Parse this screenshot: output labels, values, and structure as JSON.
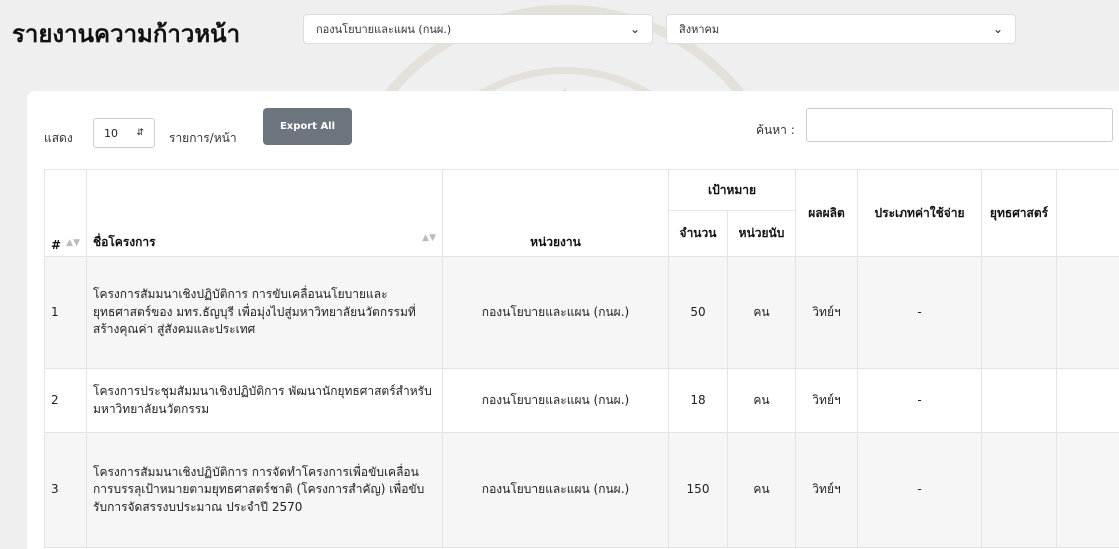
{
  "header": {
    "title": "รายงานความก้าวหน้า",
    "department_select": "กองนโยบายและแผน (กนผ.)",
    "month_select": "สิงหาคม"
  },
  "controls": {
    "show_label": "แสดง",
    "page_length": "10",
    "per_page_label": "รายการ/หน้า",
    "export_label": "Export All",
    "search_label": "ค้นหา :",
    "search_value": ""
  },
  "table": {
    "headers": {
      "index": "#",
      "project": "ชื่อโครงการ",
      "unit": "หน่วยงาน",
      "target": "เป้าหมาย",
      "amount": "จำนวน",
      "count_unit": "หน่วยนับ",
      "output": "ผลผลิต",
      "expense_type": "ประเภทค่าใช้จ่าย",
      "strategy": "ยุทธศาสตร์"
    },
    "rows": [
      {
        "index": "1",
        "project": "โครงการสัมมนาเชิงปฏิบัติการ การขับเคลื่อนนโยบายและยุทธศาสตร์ของ มทร.ธัญบุรี เพื่อมุ่งไปสู่มหาวิทยาลัยนวัตกรรมที่สร้างคุณค่า สู่สังคมและประเทศ",
        "unit": "กองนโยบายและแผน (กนผ.)",
        "amount": "50",
        "count_unit": "คน",
        "output": "วิทย์ฯ",
        "expense_type": "-",
        "strategy": ""
      },
      {
        "index": "2",
        "project": "โครงการประชุมสัมมนาเชิงปฏิบัติการ พัฒนานักยุทธศาสตร์สำหรับมหาวิทยาลัยนวัตกรรม",
        "unit": "กองนโยบายและแผน (กนผ.)",
        "amount": "18",
        "count_unit": "คน",
        "output": "วิทย์ฯ",
        "expense_type": "-",
        "strategy": ""
      },
      {
        "index": "3",
        "project": "โครงการสัมมนาเชิงปฏิบัติการ การจัดทำโครงการเพื่อขับเคลื่อนการบรรลุเป้าหมายตามยุทธศาสตร์ชาติ (โครงการสำคัญ) เพื่อขับรับการจัดสรรงบประมาณ ประจำปี 2570",
        "unit": "กองนโยบายและแผน (กนผ.)",
        "amount": "150",
        "count_unit": "คน",
        "output": "วิทย์ฯ",
        "expense_type": "-",
        "strategy": ""
      }
    ]
  }
}
